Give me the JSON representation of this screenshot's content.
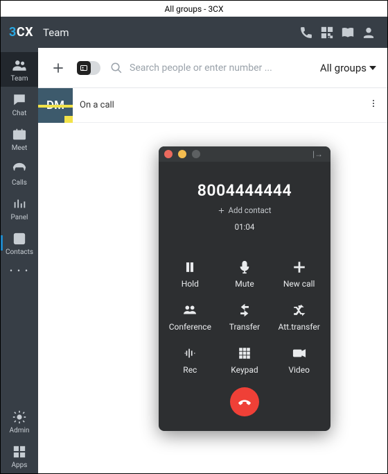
{
  "window": {
    "title": "All groups - 3CX"
  },
  "header": {
    "brand_a": "3",
    "brand_b": "CX",
    "title": "Team"
  },
  "nav": {
    "team": "Team",
    "chat": "Chat",
    "meet": "Meet",
    "calls": "Calls",
    "panel": "Panel",
    "contacts": "Contacts",
    "more": "• • •",
    "admin": "Admin",
    "apps": "Apps"
  },
  "toolbar": {
    "search_placeholder": "Search people or enter number ...",
    "groups_label": "All groups"
  },
  "roster": {
    "items": [
      {
        "initials": "DM",
        "status": "On a call"
      }
    ]
  },
  "call": {
    "number": "8004444444",
    "add_contact": "Add contact",
    "elapsed": "01:04",
    "actions": {
      "hold": "Hold",
      "mute": "Mute",
      "newcall": "New call",
      "conference": "Conference",
      "transfer": "Transfer",
      "att_transfer": "Att.transfer",
      "rec": "Rec",
      "keypad": "Keypad",
      "video": "Video"
    }
  }
}
